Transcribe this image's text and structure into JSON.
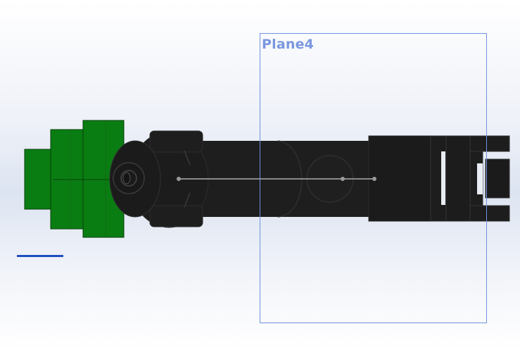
{
  "viewport": {
    "plane": {
      "label": "Plane4"
    },
    "colors": {
      "plane_outline": "#6f93dd",
      "plane_label": "#7a97df",
      "part_green": "#0a7d12",
      "part_black": "#1e1e1e",
      "sketch_line": "#8a8a8a",
      "scale_bar": "#1e4fbf"
    }
  }
}
